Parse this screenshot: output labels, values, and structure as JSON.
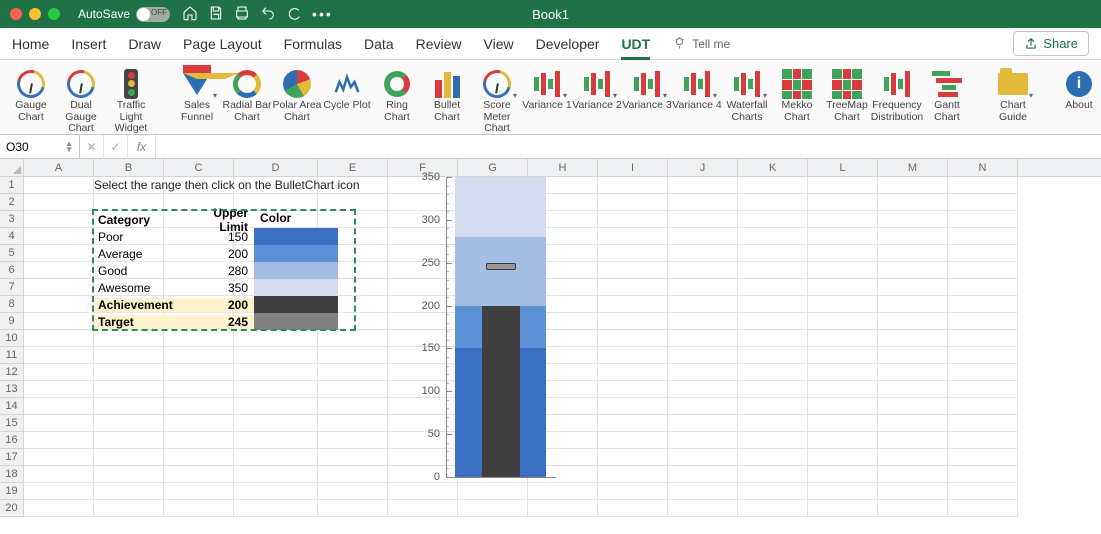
{
  "window": {
    "title": "Book1",
    "autosave_label": "AutoSave",
    "autosave_state": "OFF"
  },
  "tabs": {
    "items": [
      "Home",
      "Insert",
      "Draw",
      "Page Layout",
      "Formulas",
      "Data",
      "Review",
      "View",
      "Developer",
      "UDT"
    ],
    "active": "UDT",
    "tellme": "Tell me",
    "share": "Share"
  },
  "ribbon": {
    "groups": [
      {
        "items": [
          {
            "id": "gauge-chart",
            "label": "Gauge Chart",
            "icon": "gauge"
          },
          {
            "id": "dual-gauge-chart",
            "label": "Dual Gauge Chart",
            "icon": "gauge"
          },
          {
            "id": "traffic-light-widget",
            "label": "Traffic Light Widget",
            "icon": "traffic"
          }
        ]
      },
      {
        "items": [
          {
            "id": "sales-funnel",
            "label": "Sales Funnel",
            "icon": "funnel",
            "dd": true
          },
          {
            "id": "radial-bar-chart",
            "label": "Radial Bar Chart",
            "icon": "radial"
          },
          {
            "id": "polar-area-chart",
            "label": "Polar Area Chart",
            "icon": "polar"
          },
          {
            "id": "cycle-plot",
            "label": "Cycle Plot",
            "icon": "cycle"
          },
          {
            "id": "ring-chart",
            "label": "Ring Chart",
            "icon": "ring"
          },
          {
            "id": "bullet-chart",
            "label": "Bullet Chart",
            "icon": "bulletico"
          },
          {
            "id": "score-meter-chart",
            "label": "Score Meter Chart",
            "icon": "gauge",
            "dd": true
          },
          {
            "id": "variance-1",
            "label": "Variance 1",
            "icon": "var",
            "dd": true
          },
          {
            "id": "variance-2",
            "label": "Variance 2",
            "icon": "var",
            "dd": true
          },
          {
            "id": "variance-3",
            "label": "Variance 3",
            "icon": "var",
            "dd": true
          },
          {
            "id": "variance-4",
            "label": "Variance 4",
            "icon": "var",
            "dd": true
          },
          {
            "id": "waterfall-charts",
            "label": "Waterfall Charts",
            "icon": "var",
            "dd": true
          },
          {
            "id": "mekko-chart",
            "label": "Mekko Chart",
            "icon": "mekko"
          },
          {
            "id": "treemap-chart",
            "label": "TreeMap Chart",
            "icon": "mekko"
          },
          {
            "id": "frequency-distribution",
            "label": "Frequency Distribution",
            "icon": "var"
          },
          {
            "id": "gantt-chart",
            "label": "Gantt Chart",
            "icon": "gantt"
          }
        ]
      },
      {
        "items": [
          {
            "id": "chart-guide",
            "label": "Chart Guide",
            "icon": "folder",
            "dd": true
          }
        ]
      },
      {
        "items": [
          {
            "id": "about",
            "label": "About",
            "icon": "info"
          }
        ]
      }
    ]
  },
  "namebox": "O30",
  "fx_label": "fx",
  "columns": [
    "A",
    "B",
    "C",
    "D",
    "E",
    "F",
    "G",
    "H",
    "I",
    "J",
    "K",
    "L",
    "M",
    "N"
  ],
  "rows": 20,
  "sheet": {
    "instruction": "Select the range then click on the BulletChart icon",
    "table": {
      "headers": {
        "category": "Category",
        "upper": "Upper Limit",
        "color": "Color"
      },
      "rows": [
        {
          "category": "Poor",
          "upper": 150,
          "color": "#3b6fc1"
        },
        {
          "category": "Average",
          "upper": 200,
          "color": "#5c91d6"
        },
        {
          "category": "Good",
          "upper": 280,
          "color": "#a4bde4"
        },
        {
          "category": "Awesome",
          "upper": 350,
          "color": "#d3dcef"
        }
      ],
      "achievement": {
        "label": "Achievement",
        "value": 200,
        "swatch": "#3f3f3f"
      },
      "target": {
        "label": "Target",
        "value": 245,
        "swatch": "#808080"
      }
    }
  },
  "chart_data": {
    "type": "bar",
    "title": "",
    "ylabel": "",
    "xlabel": "",
    "ylim": [
      0,
      350
    ],
    "yticks": [
      0,
      50,
      100,
      150,
      200,
      250,
      300,
      350
    ],
    "bands": [
      {
        "name": "Poor",
        "from": 0,
        "to": 150,
        "color": "#3b6fc1"
      },
      {
        "name": "Average",
        "from": 150,
        "to": 200,
        "color": "#5c91d6"
      },
      {
        "name": "Good",
        "from": 200,
        "to": 280,
        "color": "#a4bde4"
      },
      {
        "name": "Awesome",
        "from": 280,
        "to": 350,
        "color": "#d3dcef"
      }
    ],
    "achievement": 200,
    "target": 245
  }
}
